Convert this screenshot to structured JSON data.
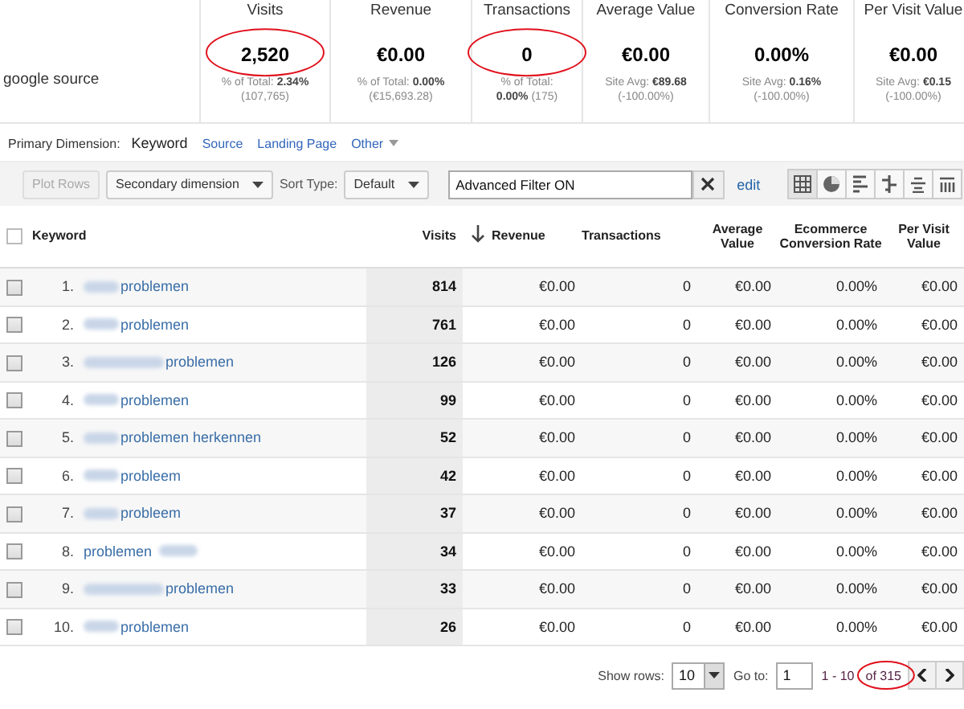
{
  "segment": "google source",
  "metrics": [
    {
      "label": "Visits",
      "value": "2,520",
      "lines": [
        "% of Total: **2.34%**",
        "(107,765)"
      ],
      "circled": true
    },
    {
      "label": "Revenue",
      "value": "€0.00",
      "lines": [
        "% of Total: **0.00%**",
        "(€15,693.28)"
      ],
      "circled": false
    },
    {
      "label": "Transactions",
      "value": "0",
      "lines": [
        "% of Total:",
        "**0.00%** (175)"
      ],
      "circled": true
    },
    {
      "label": "Average Value",
      "value": "€0.00",
      "lines": [
        "Site Avg: **€89.68**",
        "(-100.00%)"
      ],
      "circled": false
    },
    {
      "label": "Conversion Rate",
      "value": "0.00%",
      "lines": [
        "Site Avg: **0.16%**",
        "(-100.00%)"
      ],
      "circled": false
    },
    {
      "label": "Per Visit Value",
      "value": "€0.00",
      "lines": [
        "Site Avg: **€0.15**",
        "(-100.00%)"
      ],
      "circled": false
    }
  ],
  "primary_dimension": {
    "label": "Primary Dimension:",
    "options": [
      {
        "text": "Keyword",
        "selected": true,
        "kind": "link"
      },
      {
        "text": "Source",
        "selected": false,
        "kind": "link"
      },
      {
        "text": "Landing Page",
        "selected": false,
        "kind": "link"
      },
      {
        "text": "Other",
        "selected": false,
        "kind": "menu"
      }
    ]
  },
  "toolbar": {
    "plot_rows": "Plot Rows",
    "secondary": "Secondary dimension",
    "sort_label": "Sort Type:",
    "sort_value": "Default",
    "filter": "Advanced Filter ON",
    "edit": "edit"
  },
  "table": {
    "all_checked": false,
    "columns": [
      "Keyword",
      "Visits",
      "Revenue",
      "Transactions",
      "Average Value",
      "Ecommerce Conversion Rate",
      "Per Visit Value"
    ],
    "rows": [
      {
        "index": "1.",
        "kind": "prefix",
        "keyword": "problemen",
        "visits": "814",
        "revenue": "€0.00",
        "transactions": "0",
        "avg": "€0.00",
        "conv": "0.00%",
        "pvv": "€0.00",
        "checked": false
      },
      {
        "index": "2.",
        "kind": "prefix",
        "keyword": "problemen",
        "visits": "761",
        "revenue": "€0.00",
        "transactions": "0",
        "avg": "€0.00",
        "conv": "0.00%",
        "pvv": "€0.00",
        "checked": false
      },
      {
        "index": "3.",
        "kind": "long_prefix",
        "keyword": "problemen",
        "visits": "126",
        "revenue": "€0.00",
        "transactions": "0",
        "avg": "€0.00",
        "conv": "0.00%",
        "pvv": "€0.00",
        "checked": false
      },
      {
        "index": "4.",
        "kind": "prefix",
        "keyword": "problemen",
        "visits": "99",
        "revenue": "€0.00",
        "transactions": "0",
        "avg": "€0.00",
        "conv": "0.00%",
        "pvv": "€0.00",
        "checked": false
      },
      {
        "index": "5.",
        "kind": "prefix",
        "keyword": "problemen herkennen",
        "visits": "52",
        "revenue": "€0.00",
        "transactions": "0",
        "avg": "€0.00",
        "conv": "0.00%",
        "pvv": "€0.00",
        "checked": false
      },
      {
        "index": "6.",
        "kind": "prefix",
        "keyword": "probleem",
        "visits": "42",
        "revenue": "€0.00",
        "transactions": "0",
        "avg": "€0.00",
        "conv": "0.00%",
        "pvv": "€0.00",
        "checked": false
      },
      {
        "index": "7.",
        "kind": "prefix",
        "keyword": "probleem",
        "visits": "37",
        "revenue": "€0.00",
        "transactions": "0",
        "avg": "€0.00",
        "conv": "0.00%",
        "pvv": "€0.00",
        "checked": false
      },
      {
        "index": "8.",
        "kind": "suffix",
        "keyword": "problemen",
        "visits": "34",
        "revenue": "€0.00",
        "transactions": "0",
        "avg": "€0.00",
        "conv": "0.00%",
        "pvv": "€0.00",
        "checked": false
      },
      {
        "index": "9.",
        "kind": "long_prefix",
        "keyword": "problemen",
        "visits": "33",
        "revenue": "€0.00",
        "transactions": "0",
        "avg": "€0.00",
        "conv": "0.00%",
        "pvv": "€0.00",
        "checked": false
      },
      {
        "index": "10.",
        "kind": "prefix",
        "keyword": "problemen",
        "visits": "26",
        "revenue": "€0.00",
        "transactions": "0",
        "avg": "€0.00",
        "conv": "0.00%",
        "pvv": "€0.00",
        "checked": false
      }
    ]
  },
  "pager": {
    "show_rows_label": "Show rows:",
    "show_rows": "10",
    "goto_label": "Go to:",
    "goto": "1",
    "range": "1 - 10",
    "total": "of 315",
    "total_circled": true
  }
}
